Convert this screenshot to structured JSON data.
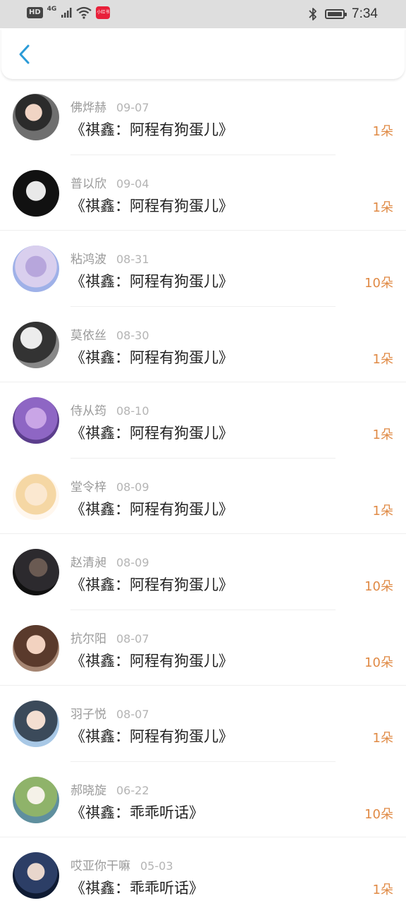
{
  "status_bar": {
    "hd": "HD",
    "network": "4G",
    "app_badge": "小红书",
    "time": "7:34"
  },
  "header": {
    "back_icon": "chevron-left-icon",
    "accent_color": "#2b9bd7"
  },
  "colors": {
    "count": "#e08a45",
    "name": "#9a9a9a",
    "title": "#222222"
  },
  "items": [
    {
      "name": "佛烨赫",
      "date": "09-07",
      "title": "《祺鑫：阿程有狗蛋儿》",
      "count": "1朵"
    },
    {
      "name": "普以欣",
      "date": "09-04",
      "title": "《祺鑫：阿程有狗蛋儿》",
      "count": "1朵"
    },
    {
      "name": "粘鸿波",
      "date": "08-31",
      "title": "《祺鑫：阿程有狗蛋儿》",
      "count": "10朵"
    },
    {
      "name": "莫依丝",
      "date": "08-30",
      "title": "《祺鑫：阿程有狗蛋儿》",
      "count": "1朵"
    },
    {
      "name": "侍从筠",
      "date": "08-10",
      "title": "《祺鑫：阿程有狗蛋儿》",
      "count": "1朵"
    },
    {
      "name": "堂令梓",
      "date": "08-09",
      "title": "《祺鑫：阿程有狗蛋儿》",
      "count": "1朵"
    },
    {
      "name": "赵清昶",
      "date": "08-09",
      "title": "《祺鑫：阿程有狗蛋儿》",
      "count": "10朵"
    },
    {
      "name": "抗尔阳",
      "date": "08-07",
      "title": "《祺鑫：阿程有狗蛋儿》",
      "count": "10朵"
    },
    {
      "name": "羽子悦",
      "date": "08-07",
      "title": "《祺鑫：阿程有狗蛋儿》",
      "count": "1朵"
    },
    {
      "name": "郝晓旋",
      "date": "06-22",
      "title": "《祺鑫：乖乖听话》",
      "count": "10朵"
    },
    {
      "name": "哎亚你干嘛",
      "date": "05-03",
      "title": "《祺鑫：乖乖听话》",
      "count": "1朵"
    }
  ]
}
